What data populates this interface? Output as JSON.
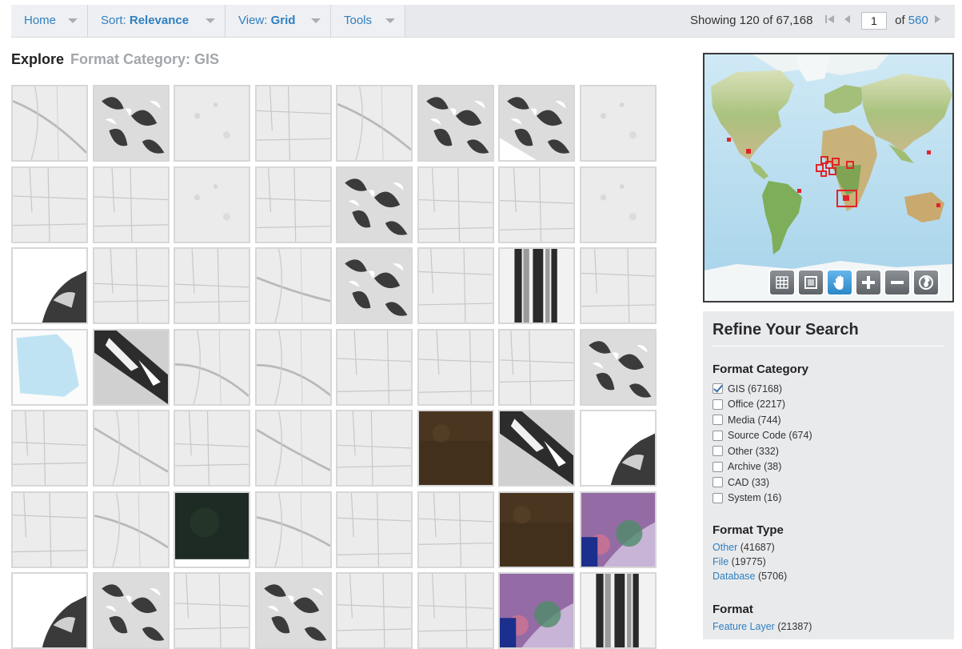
{
  "toolbar": {
    "home": "Home",
    "sort_prefix": "Sort: ",
    "sort_value": "Relevance",
    "view_prefix": "View: ",
    "view_value": "Grid",
    "tools": "Tools"
  },
  "pagination": {
    "showing_label": "Showing 120 of 67,168",
    "current_page": "1",
    "of_label": "of",
    "total_pages": "560"
  },
  "heading": {
    "title": "Explore",
    "crumb": "Format Category: GIS"
  },
  "grid": {
    "tile_count": 56
  },
  "map": {
    "controls": [
      "grid-extent",
      "box-select",
      "pan",
      "zoom-in",
      "zoom-out",
      "full-extent"
    ],
    "active_control": "pan",
    "marker_color": "#e0242a"
  },
  "refine": {
    "title": "Refine Your Search",
    "format_category": {
      "label": "Format Category",
      "options": [
        {
          "label": "GIS (67168)",
          "checked": true
        },
        {
          "label": "Office (2217)",
          "checked": false
        },
        {
          "label": "Media (744)",
          "checked": false
        },
        {
          "label": "Source Code (674)",
          "checked": false
        },
        {
          "label": "Other (332)",
          "checked": false
        },
        {
          "label": "Archive (38)",
          "checked": false
        },
        {
          "label": "CAD (33)",
          "checked": false
        },
        {
          "label": "System (16)",
          "checked": false
        }
      ]
    },
    "format_type": {
      "label": "Format Type",
      "items": [
        {
          "link": "Other",
          "count": "(41687)"
        },
        {
          "link": "File",
          "count": "(19775)"
        },
        {
          "link": "Database",
          "count": "(5706)"
        }
      ]
    },
    "format": {
      "label": "Format",
      "items": [
        {
          "link": "Feature Layer",
          "count": "(21387)"
        }
      ]
    }
  },
  "colors": {
    "link": "#2f7fc1",
    "toolbar_bg": "#eef0f3",
    "muted": "#a3a7ac"
  }
}
